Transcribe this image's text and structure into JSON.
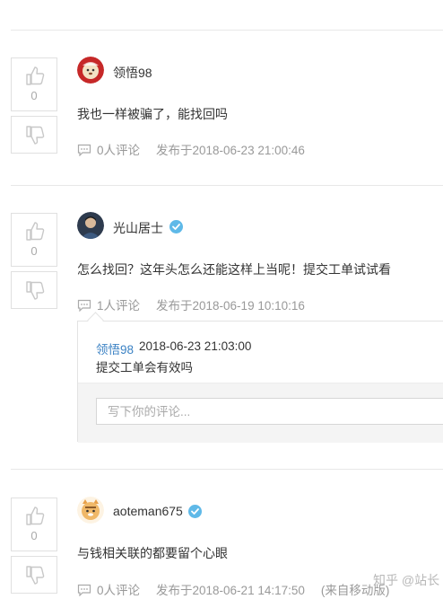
{
  "comments": [
    {
      "votes": "0",
      "username": "领悟98",
      "content": "我也一样被骗了，能找回吗",
      "comment_count": "0人评论",
      "published": "发布于2018-06-23 21:00:46",
      "verified": false
    },
    {
      "votes": "0",
      "username": "光山居士",
      "content": "怎么找回？这年头怎么还能这样上当呢！提交工单试试看",
      "comment_count": "1人评论",
      "published": "发布于2018-06-19 10:10:16",
      "verified": true,
      "reply": {
        "user": "领悟98",
        "time": "2018-06-23 21:03:00",
        "text": "提交工单会有效吗",
        "input_placeholder": "写下你的评论..."
      }
    },
    {
      "votes": "0",
      "username": "aoteman675",
      "content": "与钱相关联的都要留个心眼",
      "comment_count": "0人评论",
      "published": "发布于2018-06-21 14:17:50",
      "source": "(来自移动版)",
      "verified": true
    }
  ],
  "watermark": "知乎 @站长",
  "colors": {
    "link": "#3b82c4",
    "meta": "#999999",
    "verified": "#5fb9e8",
    "border": "#e0e0e0"
  },
  "icons": [
    "thumbs-up-icon",
    "thumbs-down-icon",
    "comment-icon",
    "verified-icon"
  ]
}
